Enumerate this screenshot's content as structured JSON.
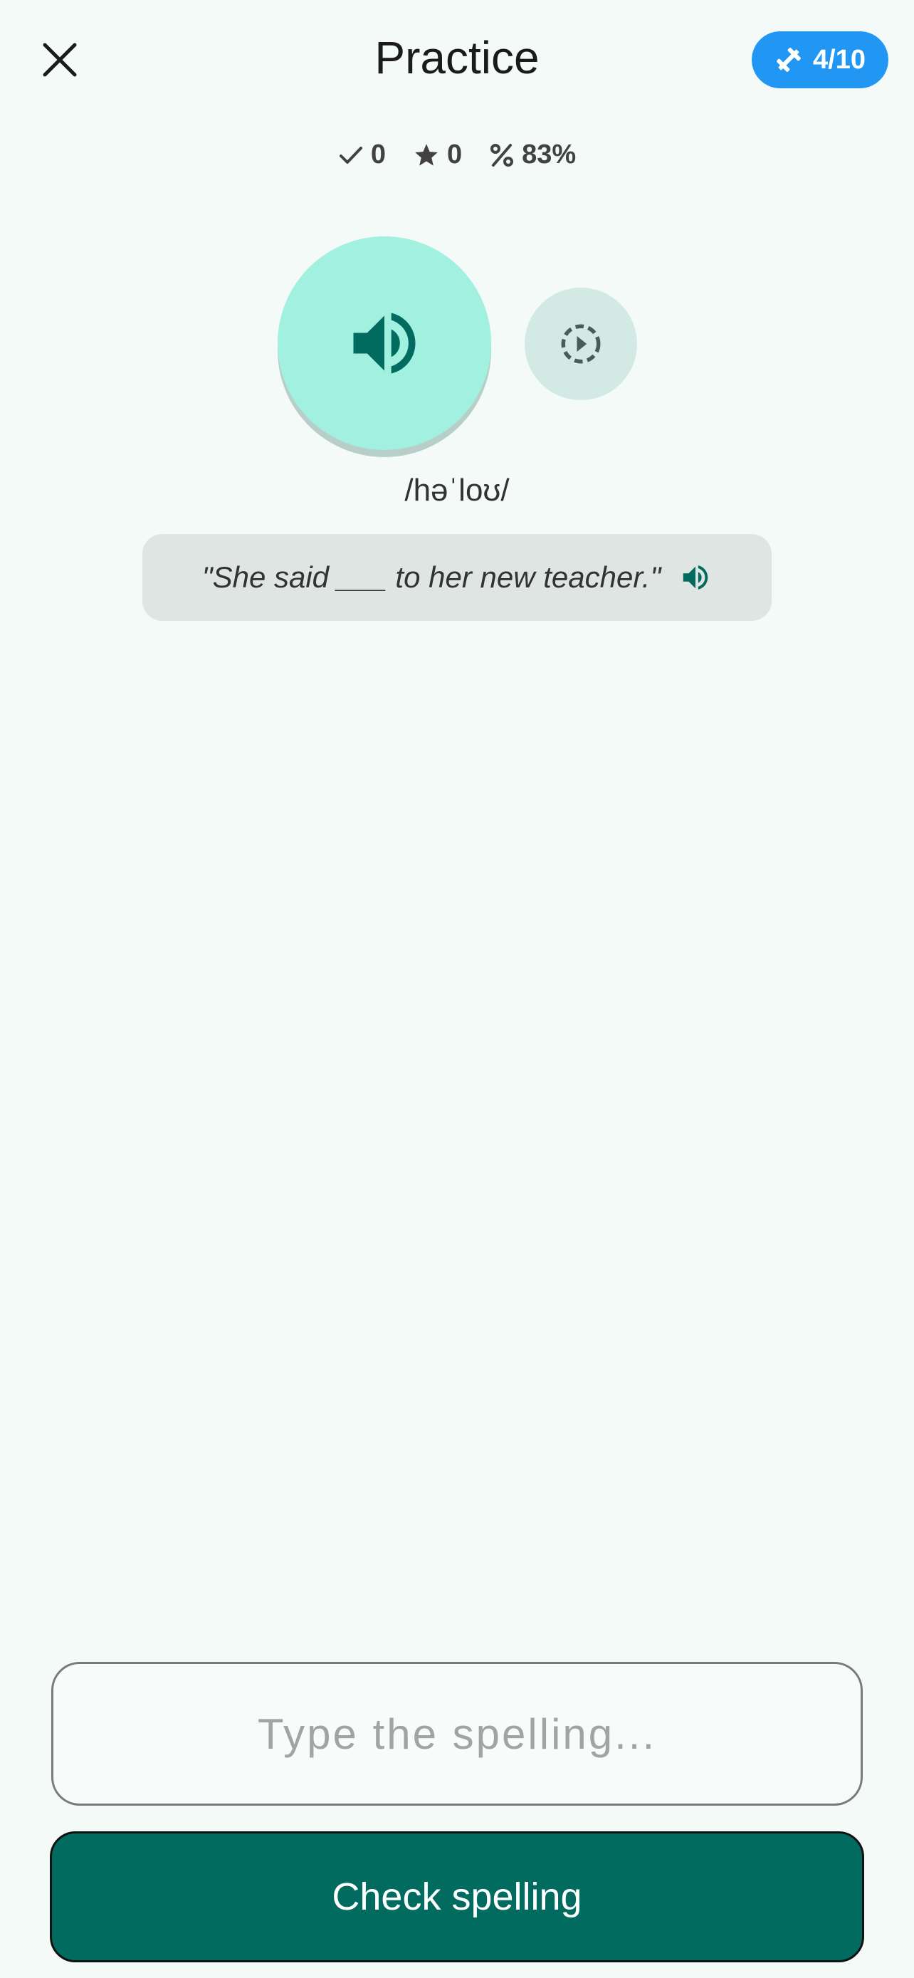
{
  "header": {
    "title": "Practice",
    "progress": "4/10"
  },
  "stats": {
    "correct": "0",
    "stars": "0",
    "accuracy": "83%"
  },
  "word": {
    "phonetic": "/həˈloʊ/",
    "example_sentence": "\"She said ___ to her new teacher.\""
  },
  "input": {
    "value": "",
    "placeholder": "Type the spelling..."
  },
  "actions": {
    "check_label": "Check spelling"
  },
  "colors": {
    "background": "#f3faf8",
    "accent": "#006b5e",
    "progress_pill": "#2196f3",
    "play_button": "#a2f0e0",
    "slow_button": "#d3e9e3"
  },
  "icons": {
    "close": "close-icon",
    "progress": "dumbbell-icon",
    "correct": "check-icon",
    "stars": "star-icon",
    "accuracy": "percent-icon",
    "play": "volume-icon",
    "slow_play": "slow-motion-play-icon",
    "sentence_audio": "volume-icon"
  }
}
